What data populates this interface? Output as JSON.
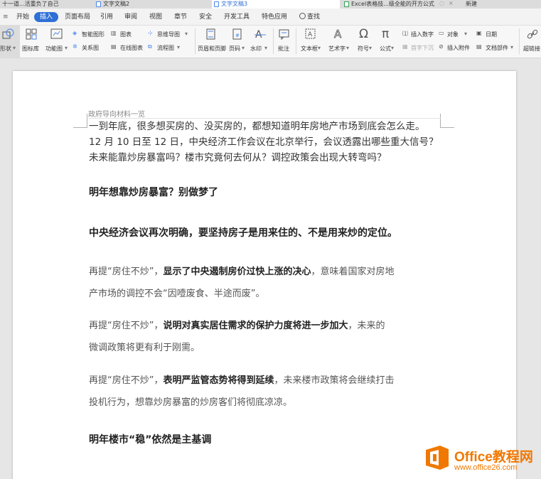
{
  "tabs": [
    {
      "label": "十一道...活重负了自己",
      "active": false
    },
    {
      "label": "文字文稿2",
      "active": false
    },
    {
      "label": "文字文稿3",
      "active": true
    },
    {
      "label": "Excel表格技...级全能的开方公式",
      "active": false
    },
    {
      "label": "新建",
      "active": false
    }
  ],
  "menu": {
    "items": [
      "开始",
      "插入",
      "页面布局",
      "引用",
      "审阅",
      "视图",
      "章节",
      "安全",
      "开发工具",
      "特色应用"
    ],
    "active": "插入",
    "search": "查找"
  },
  "ribbon": {
    "shape": "形状",
    "icon_lib": "图标库",
    "func_icon": "功能图",
    "smart_shape": "智能图形",
    "chart": "图表",
    "mind_map": "思维导图",
    "relation": "关系图",
    "online_chart": "在线图表",
    "flowchart": "流程图",
    "header_footer": "页眉和页脚",
    "page_num": "页码",
    "watermark": "水印",
    "comment": "批注",
    "textbox": "文本框",
    "wordart": "艺术字",
    "symbol": "符号",
    "formula": "公式",
    "insert_number": "插入数字",
    "object": "对象",
    "date": "日期",
    "drop_cap": "首字下沉",
    "attachment": "插入附件",
    "doc_parts": "文档部件",
    "hyperlink": "超链接"
  },
  "document": {
    "header": "政府导向材料一览",
    "intro": [
      "一到年底，很多想买房的、没买房的，都想知道明年房地产市场到底会怎么走。",
      "12 月 10 日至 12 日，中央经济工作会议在北京举行，会议透露出哪些重大信号？",
      "未来能靠炒房暴富吗？楼市究竟何去何从？调控政策会出现大转弯吗？"
    ],
    "heading1": "明年想靠炒房暴富？别做梦了",
    "heading2": "中央经济会议再次明确，要坚持房子是用来住的、不是用来炒的定位。",
    "para1": {
      "pre": "再提“房住不炒”，",
      "bold": "显示了中央遏制房价过快上涨的决心",
      "post": "，意味着国家对房地",
      "line2": "产市场的调控不会“因噎废食、半途而废”。"
    },
    "para2": {
      "pre": "再提“房住不炒”，",
      "bold": "说明对真实居住需求的保护力度将进一步加大",
      "post": "，未来的",
      "line2": "微调政策将更有利于刚需。"
    },
    "para3": {
      "pre": "再提“房住不炒”，",
      "bold": "表明严监管态势将得到延续",
      "post": "，未来楼市政策将会继续打击",
      "line2": "投机行为，想靠炒房暴富的炒房客们将彻底凉凉。"
    },
    "heading3": "明年楼市“稳”依然是主基调"
  },
  "watermark": {
    "title": "Office教程网",
    "url": "www.office26.com"
  },
  "colors": {
    "accent": "#2f6fd6",
    "watermark": "#f07800"
  }
}
